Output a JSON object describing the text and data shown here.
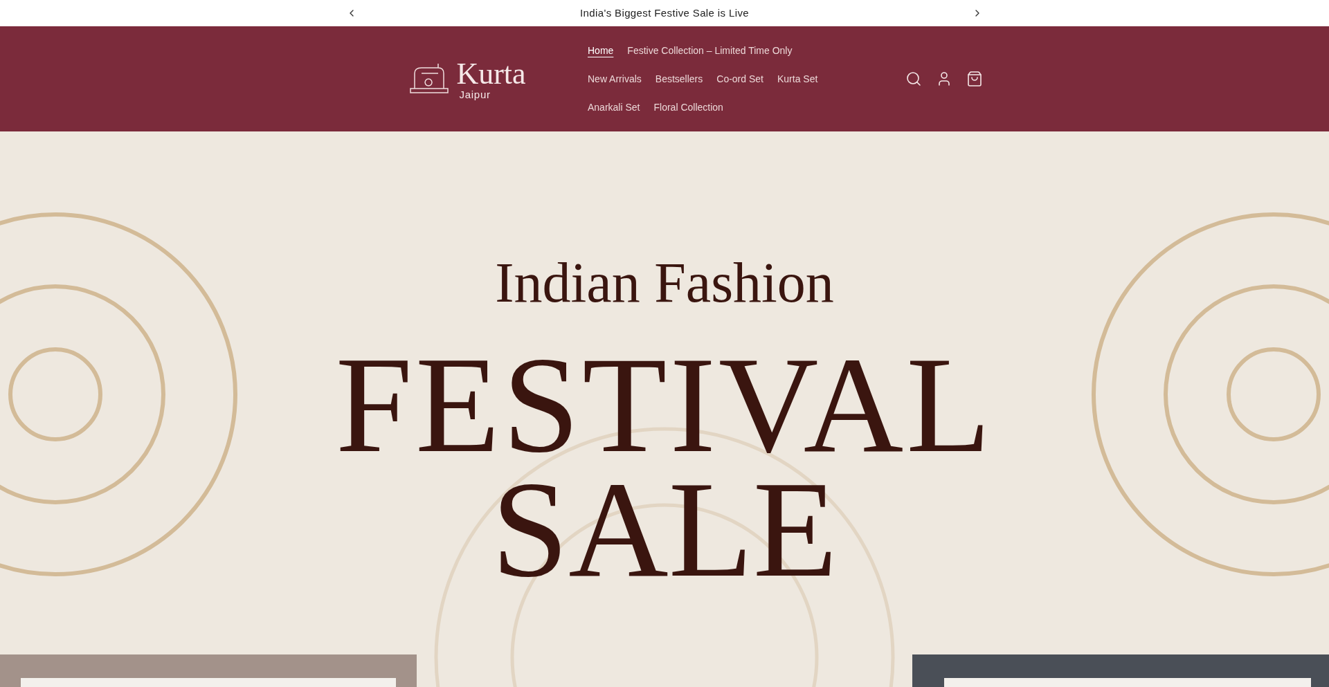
{
  "announcement": {
    "text": "India's Biggest Festive Sale is Live"
  },
  "logo": {
    "name": "Kurta",
    "sub": "Jaipur"
  },
  "nav": [
    {
      "label": "Home",
      "selected": true
    },
    {
      "label": "Festive Collection – Limited Time Only",
      "selected": false
    },
    {
      "label": "New Arrivals",
      "selected": false
    },
    {
      "label": "Bestsellers",
      "selected": false
    },
    {
      "label": "Co-ord Set",
      "selected": false
    },
    {
      "label": "Kurta Set",
      "selected": false
    },
    {
      "label": "Anarkali Set",
      "selected": false
    },
    {
      "label": "Floral Collection",
      "selected": false
    }
  ],
  "hero": {
    "kind": "picture",
    "kicker": "Indian Fashion",
    "headline": [
      "FESTIVAL",
      "SALE"
    ]
  }
}
